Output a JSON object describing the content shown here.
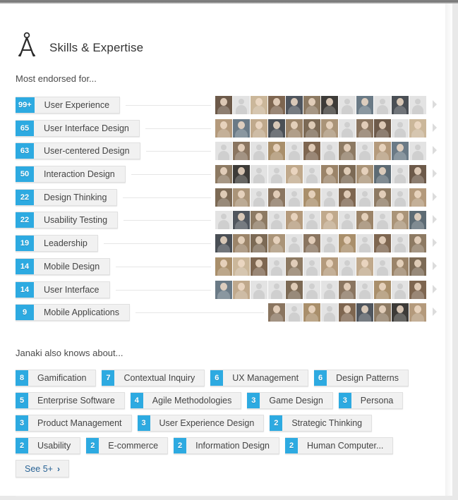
{
  "header": {
    "title": "Skills & Expertise",
    "icon": "compass-divider-icon"
  },
  "sections": {
    "most_endorsed_label": "Most endorsed for...",
    "also_knows_label": "Janaki also knows about..."
  },
  "endorsed_skills": [
    {
      "count": "99+",
      "name": "User Experience",
      "endorsers": 12,
      "align": "left",
      "placeholders": [
        1,
        7,
        9,
        11
      ]
    },
    {
      "count": "65",
      "name": "User Interface Design",
      "endorsers": 12,
      "align": "left",
      "placeholders": [
        7,
        10
      ]
    },
    {
      "count": "63",
      "name": "User-centered Design",
      "endorsers": 12,
      "align": "left",
      "placeholders": [
        0,
        2,
        4,
        6,
        8,
        11
      ]
    },
    {
      "count": "50",
      "name": "Interaction Design",
      "endorsers": 12,
      "align": "left",
      "placeholders": [
        2,
        3,
        5,
        10
      ]
    },
    {
      "count": "22",
      "name": "Design Thinking",
      "endorsers": 12,
      "align": "left",
      "placeholders": [
        2,
        4,
        6,
        8,
        10
      ]
    },
    {
      "count": "22",
      "name": "Usability Testing",
      "endorsers": 12,
      "align": "left",
      "placeholders": [
        0,
        3,
        5,
        7,
        9
      ]
    },
    {
      "count": "19",
      "name": "Leadership",
      "endorsers": 12,
      "align": "left",
      "placeholders": [
        4,
        6,
        8,
        10
      ]
    },
    {
      "count": "14",
      "name": "Mobile Design",
      "endorsers": 12,
      "align": "left",
      "placeholders": [
        3,
        5,
        7,
        9
      ]
    },
    {
      "count": "14",
      "name": "User Interface",
      "endorsers": 12,
      "align": "left",
      "placeholders": [
        2,
        3,
        5,
        6,
        8,
        10
      ]
    },
    {
      "count": "9",
      "name": "Mobile Applications",
      "endorsers": 9,
      "align": "right",
      "placeholders": [
        1,
        3
      ]
    }
  ],
  "also_knows": [
    [
      {
        "count": "8",
        "name": "Gamification"
      },
      {
        "count": "7",
        "name": "Contextual Inquiry"
      },
      {
        "count": "6",
        "name": "UX Management"
      },
      {
        "count": "6",
        "name": "Design Patterns"
      }
    ],
    [
      {
        "count": "5",
        "name": "Enterprise Software"
      },
      {
        "count": "4",
        "name": "Agile Methodologies"
      },
      {
        "count": "3",
        "name": "Game Design"
      },
      {
        "count": "3",
        "name": "Persona"
      }
    ],
    [
      {
        "count": "3",
        "name": "Product Management"
      },
      {
        "count": "3",
        "name": "User Experience Design"
      },
      {
        "count": "2",
        "name": "Strategic Thinking"
      }
    ],
    [
      {
        "count": "2",
        "name": "Usability"
      },
      {
        "count": "2",
        "name": "E-commerce"
      },
      {
        "count": "2",
        "name": "Information Design"
      },
      {
        "count": "2",
        "name": "Human Computer..."
      }
    ]
  ],
  "see_more": {
    "label": "See 5+",
    "chevron": "›"
  },
  "colors": {
    "badge_blue": "#2daae1",
    "pill_gray": "#f1f1f1",
    "link_blue": "#2a6496",
    "text_dark": "#333333"
  }
}
